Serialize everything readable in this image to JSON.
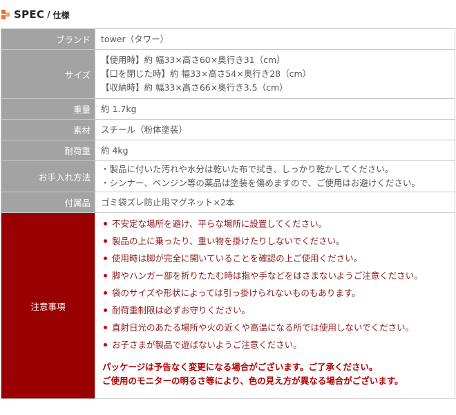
{
  "heading": {
    "title": "SPEC",
    "separator": "/",
    "subtitle": "仕様"
  },
  "colors": {
    "label_bg": "#a3a3a3",
    "caution_bg": "#990000",
    "accent": "#e8742a",
    "caution_text": "#8b1a1a",
    "notice_text": "#b30000"
  },
  "spec": {
    "brand": {
      "label": "ブランド",
      "value": "tower（タワー）"
    },
    "size": {
      "label": "サイズ",
      "lines": [
        "【使用時】約 幅33×高さ60×奥行き31（cm）",
        "【口を閉じた時】約 幅33×高さ54×奥行き28（cm）",
        "【収納時】約 幅33×高さ66×奥行き3.5（cm）"
      ]
    },
    "weight": {
      "label": "重量",
      "value": "約 1.7kg"
    },
    "material": {
      "label": "素材",
      "value": "スチール（粉体塗装）"
    },
    "load": {
      "label": "耐荷重",
      "value": "約 4kg"
    },
    "care": {
      "label": "お手入れ方法",
      "lines": [
        "・製品に付いた汚れや水分は乾いた布で拭き、しっかり乾かしてください。",
        "・シンナー、ベンジン等の薬品は塗装を傷めますので、ご使用はお避けください。"
      ]
    },
    "accessories": {
      "label": "付属品",
      "value": "ゴミ袋ズレ防止用マグネット×2本"
    },
    "caution": {
      "label": "注意事項",
      "items": [
        "不安定な場所を避け、平らな場所に設置してください。",
        "製品の上に乗ったり、重い物を掛けたりしないでください。",
        "使用時は脚が完全に開いていることを確認の上ご使用ください。",
        "脚やハンガー部を折りたたむ時は指や手などをはさまないようご注意ください。",
        "袋のサイズや形状によっては引っ掛けられないものもあります。",
        "耐荷重制限は必ずお守りください。",
        "直射日光のあたる場所や火の近くや高温になる所では使用しないでください。",
        "お子さまが製品で遊ばないようご注意ください。"
      ],
      "notice": [
        "パッケージは予告なく変更になる場合がございます。ご了承ください。",
        "ご使用のモニターの明るさ等により、色の見え方が異なる場合がございます。"
      ]
    }
  }
}
